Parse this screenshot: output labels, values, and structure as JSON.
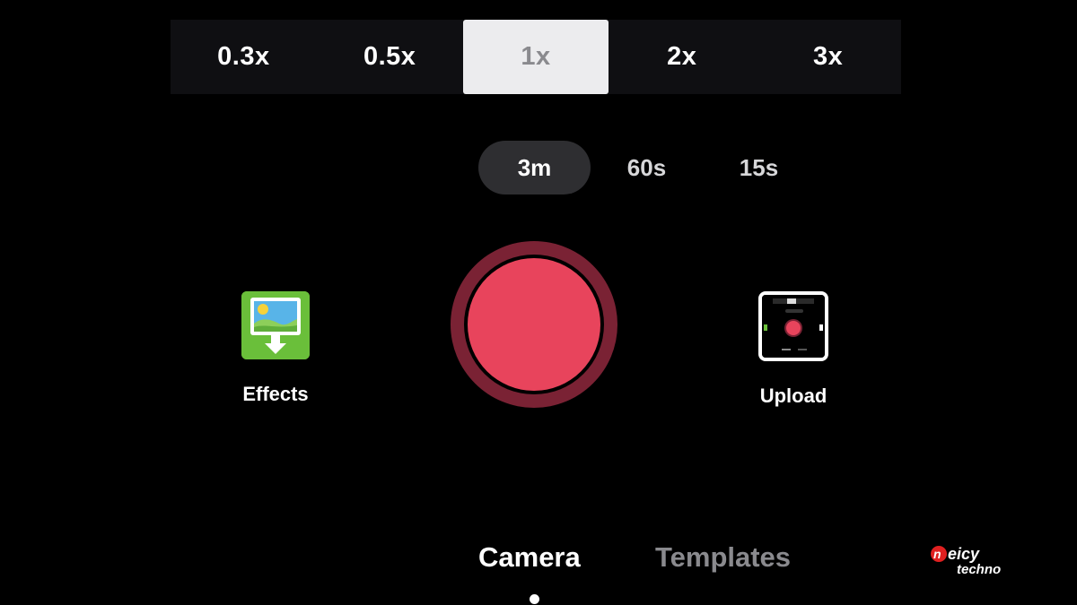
{
  "speed": {
    "options": [
      "0.3x",
      "0.5x",
      "1x",
      "2x",
      "3x"
    ],
    "selected": "1x"
  },
  "duration": {
    "options": [
      "3m",
      "60s",
      "15s"
    ],
    "selected": "3m"
  },
  "record": {
    "icon": "record-icon",
    "color": "#e8445c",
    "ring_color": "#7a2234"
  },
  "effects": {
    "label": "Effects",
    "icon": "gallery-download-icon",
    "color": "#6abf3a"
  },
  "upload": {
    "label": "Upload",
    "icon": "upload-thumbnail-icon"
  },
  "tabs": {
    "camera": "Camera",
    "templates": "Templates",
    "active": "Camera"
  },
  "watermark": {
    "logo": "neicy-techno-logo",
    "text": "neicy techno"
  }
}
